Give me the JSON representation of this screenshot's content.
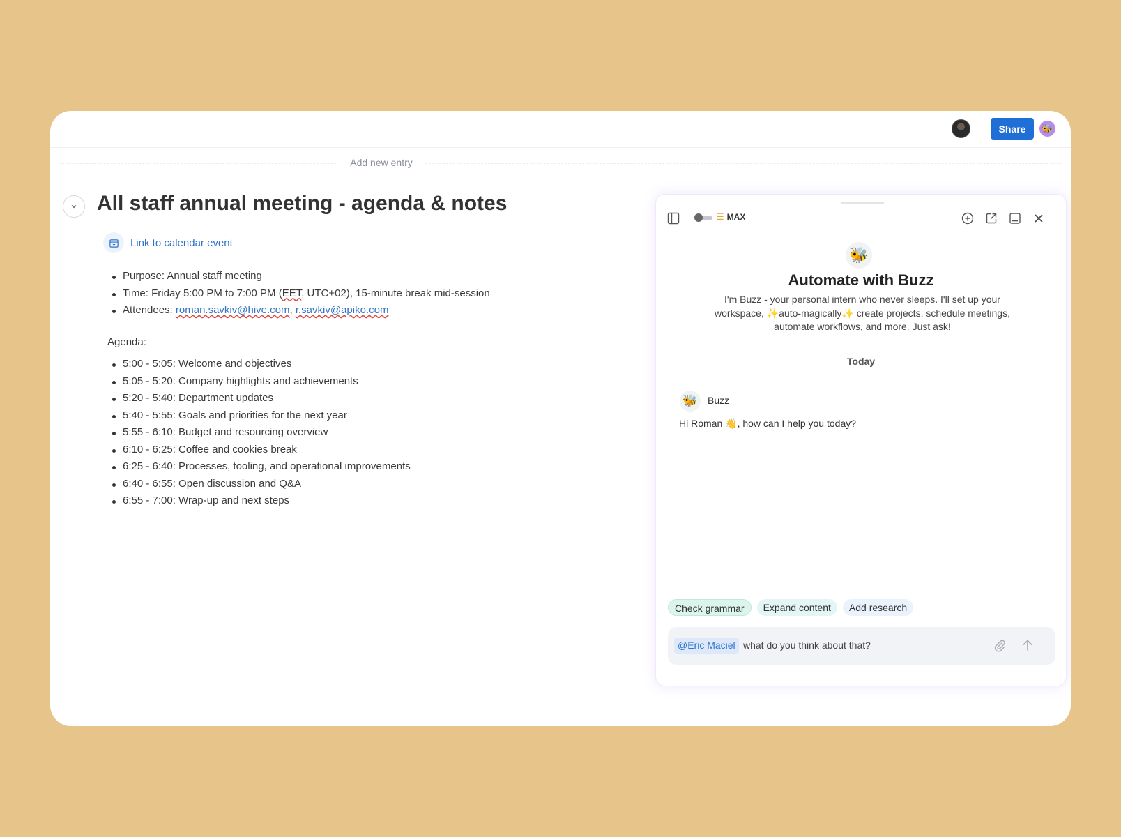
{
  "topbar": {
    "share_label": "Share"
  },
  "editor": {
    "add_entry_label": "Add new entry",
    "title": "All staff annual meeting - agenda & notes",
    "calendar_link": "Link to calendar event",
    "meta": {
      "purpose": "Purpose: Annual staff meeting",
      "time_prefix": "Time: Friday 5:00 PM to 7:00 PM (",
      "time_tz": "EET",
      "time_suffix": ", UTC+02), 15-minute break mid-session",
      "attendees_prefix": "Attendees: ",
      "email_1": "roman.savkiv@hive.com",
      "separator": ", ",
      "email_2": "r.savkiv@apiko.com"
    },
    "agenda_label": "Agenda:",
    "agenda": [
      "5:00 - 5:05: Welcome and objectives",
      "5:05 - 5:20: Company highlights and achievements",
      "5:20 - 5:40: Department updates",
      "5:40 - 5:55: Goals and priorities for the next year",
      "5:55 - 6:10: Budget and resourcing overview",
      "6:10 - 6:25: Coffee and cookies break",
      "6:25 - 6:40: Processes, tooling, and operational improvements",
      "6:40 - 6:55: Open discussion and Q&A",
      "6:55 - 7:00: Wrap-up and next steps"
    ]
  },
  "buzz": {
    "mode_label": "MAX",
    "title": "Automate with Buzz",
    "description": "I'm Buzz - your personal intern who never sleeps. I'll set up your workspace, ✨auto-magically✨ create projects, schedule meetings, automate workflows, and more. Just ask!",
    "day_separator": "Today",
    "message": {
      "sender": "Buzz",
      "text": "Hi Roman 👋, how can I help you today?"
    },
    "suggestions": [
      "Check grammar",
      "Expand content",
      "Add research"
    ],
    "composer": {
      "mention": "@Eric Maciel",
      "text": "what do you think about that?"
    }
  },
  "icons": {
    "panel_toggle": "sidebar-panel-icon",
    "new_chat": "plus-circle-icon",
    "open_external": "external-link-icon",
    "minimize": "minimize-icon",
    "close": "close-icon",
    "attach": "paperclip-icon",
    "send": "arrow-up-icon",
    "calendar": "calendar-icon",
    "bee": "bee-icon"
  },
  "colors": {
    "background": "#e7c58a",
    "accent": "#1f6fd6",
    "link": "#2f74c9"
  }
}
